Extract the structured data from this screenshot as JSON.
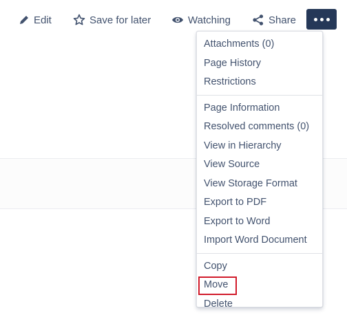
{
  "toolbar": {
    "edit_label": "Edit",
    "save_label": "Save for later",
    "watching_label": "Watching",
    "share_label": "Share",
    "more_icon": "ellipsis-icon"
  },
  "menu": {
    "sections": [
      {
        "items": [
          "Attachments (0)",
          "Page History",
          "Restrictions"
        ]
      },
      {
        "items": [
          "Page Information",
          "Resolved comments (0)",
          "View in Hierarchy",
          "View Source",
          "View Storage Format",
          "Export to PDF",
          "Export to Word",
          "Import Word Document"
        ]
      },
      {
        "items": [
          "Copy",
          "Move",
          "Delete"
        ]
      }
    ],
    "highlighted_item": "Move"
  },
  "colors": {
    "more_button_bg": "#253858",
    "text": "#42526e",
    "highlight_border": "#d11a2a"
  }
}
